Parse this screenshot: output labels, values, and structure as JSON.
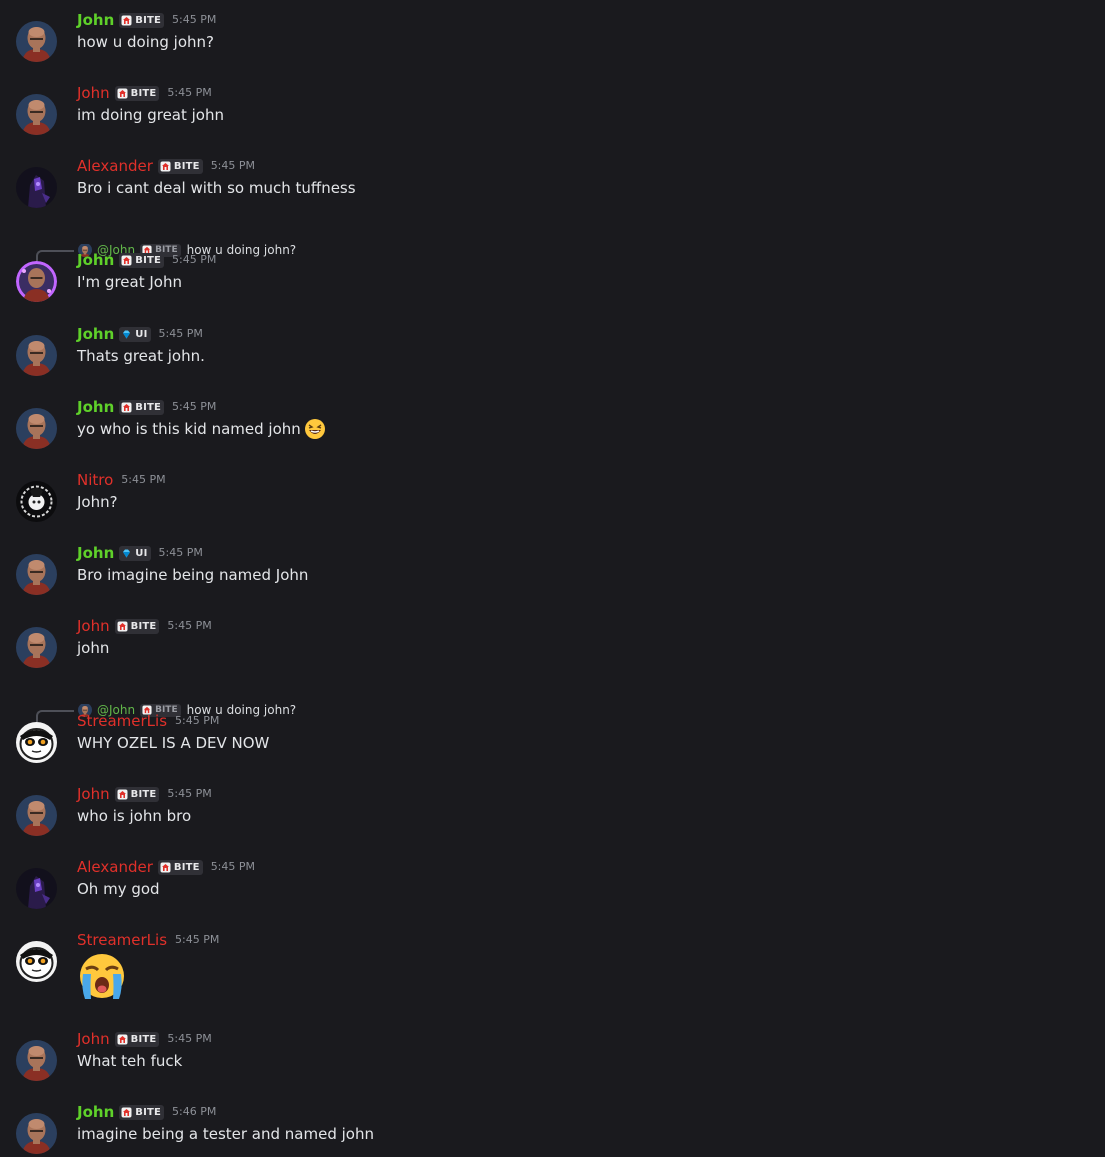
{
  "colors": {
    "background": "#1a1a1e",
    "green_name": "#5fd12a",
    "red_name": "#e0302a",
    "muted": "#8d9097",
    "text": "#e3e5e8"
  },
  "messages": [
    {
      "author": "John",
      "name_color": "green",
      "avatar": "john",
      "badge": {
        "icon": "home-shield-icon",
        "label": "BITE"
      },
      "time": "5:45 PM",
      "text": "how u doing john?"
    },
    {
      "author": "John",
      "name_color": "red",
      "avatar": "john",
      "badge": {
        "icon": "home-shield-icon",
        "label": "BITE"
      },
      "time": "5:45 PM",
      "text": "im doing great john"
    },
    {
      "author": "Alexander",
      "name_color": "red",
      "avatar": "alexander",
      "badge": {
        "icon": "home-shield-icon",
        "label": "BITE"
      },
      "time": "5:45 PM",
      "text": "Bro i cant deal with so much tuffness"
    },
    {
      "reply": {
        "mention": "@John",
        "badge": "BITE",
        "text": "how u doing john?"
      },
      "author": "John",
      "name_color": "green",
      "avatar": "john-glow",
      "badge": {
        "icon": "home-shield-icon",
        "label": "BITE"
      },
      "time": "5:45 PM",
      "text": "I'm great John"
    },
    {
      "author": "John",
      "name_color": "green",
      "avatar": "john",
      "badge": {
        "icon": "diamond-icon",
        "label": "UI"
      },
      "time": "5:45 PM",
      "text": "Thats great john."
    },
    {
      "author": "John",
      "name_color": "green",
      "avatar": "john",
      "badge": {
        "icon": "home-shield-icon",
        "label": "BITE"
      },
      "time": "5:45 PM",
      "text": "yo who is this kid named john",
      "emoji": "laughing-face-emoji"
    },
    {
      "author": "Nitro",
      "name_color": "red",
      "avatar": "nitro",
      "time": "5:45 PM",
      "text": "John?"
    },
    {
      "author": "John",
      "name_color": "green",
      "avatar": "john",
      "badge": {
        "icon": "diamond-icon",
        "label": "UI"
      },
      "time": "5:45 PM",
      "text": "Bro imagine being named John"
    },
    {
      "author": "John",
      "name_color": "red",
      "avatar": "john",
      "badge": {
        "icon": "home-shield-icon",
        "label": "BITE"
      },
      "time": "5:45 PM",
      "text": "john"
    },
    {
      "reply": {
        "mention": "@John",
        "badge": "BITE",
        "text": "how u doing john?"
      },
      "author": "StreamerLis",
      "name_color": "red",
      "avatar": "streamer",
      "time": "5:45 PM",
      "text": "WHY OZEL IS A DEV NOW"
    },
    {
      "author": "John",
      "name_color": "red",
      "avatar": "john",
      "badge": {
        "icon": "home-shield-icon",
        "label": "BITE"
      },
      "time": "5:45 PM",
      "text": "who is john bro"
    },
    {
      "author": "Alexander",
      "name_color": "red",
      "avatar": "alexander",
      "badge": {
        "icon": "home-shield-icon",
        "label": "BITE"
      },
      "time": "5:45 PM",
      "text": "Oh my god"
    },
    {
      "author": "StreamerLis",
      "name_color": "red",
      "avatar": "streamer",
      "time": "5:45 PM",
      "big_emoji": "loudly-crying-face-emoji"
    },
    {
      "author": "John",
      "name_color": "red",
      "avatar": "john",
      "badge": {
        "icon": "home-shield-icon",
        "label": "BITE"
      },
      "time": "5:45 PM",
      "text": "What teh fuck"
    },
    {
      "author": "John",
      "name_color": "green",
      "avatar": "john",
      "badge": {
        "icon": "home-shield-icon",
        "label": "BITE"
      },
      "time": "5:46 PM",
      "text": "imagine being a tester and named john"
    }
  ]
}
